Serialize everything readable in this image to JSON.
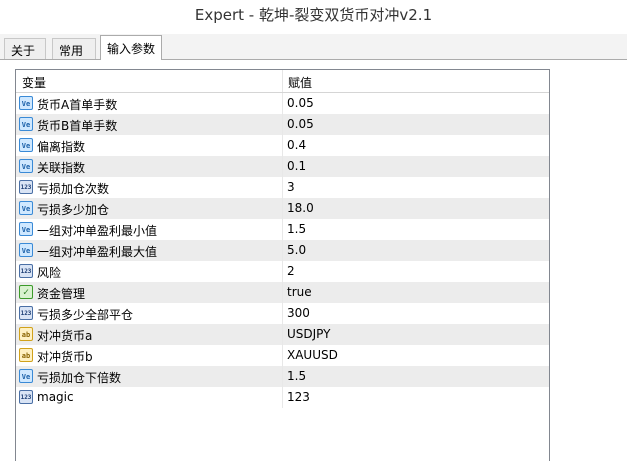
{
  "window": {
    "title": "Expert - 乾坤-裂变双货币对冲v2.1"
  },
  "tabs": [
    {
      "label": "关于"
    },
    {
      "label": "常用"
    },
    {
      "label": "输入参数"
    }
  ],
  "table": {
    "headers": {
      "variable": "变量",
      "value": "赋值"
    },
    "rows": [
      {
        "icon": "double-icon",
        "glyph": "Ve",
        "name": "货币A首单手数",
        "value": "0.05"
      },
      {
        "icon": "double-icon",
        "glyph": "Ve",
        "name": "货币B首单手数",
        "value": "0.05"
      },
      {
        "icon": "double-icon",
        "glyph": "Ve",
        "name": "偏离指数",
        "value": "0.4"
      },
      {
        "icon": "double-icon",
        "glyph": "Ve",
        "name": "关联指数",
        "value": "0.1"
      },
      {
        "icon": "integer-icon",
        "glyph": "123",
        "name": "亏损加仓次数",
        "value": "3"
      },
      {
        "icon": "double-icon",
        "glyph": "Ve",
        "name": "亏损多少加仓",
        "value": "18.0"
      },
      {
        "icon": "double-icon",
        "glyph": "Ve",
        "name": "一组对冲单盈利最小值",
        "value": "1.5"
      },
      {
        "icon": "double-icon",
        "glyph": "Ve",
        "name": "一组对冲单盈利最大值",
        "value": "5.0"
      },
      {
        "icon": "integer-icon",
        "glyph": "123",
        "name": "风险",
        "value": "2"
      },
      {
        "icon": "boolean-icon",
        "glyph": "✓",
        "name": "资金管理",
        "value": "true"
      },
      {
        "icon": "integer-icon",
        "glyph": "123",
        "name": "亏损多少全部平仓",
        "value": "300"
      },
      {
        "icon": "string-icon",
        "glyph": "ab",
        "name": "对冲货币a",
        "value": "USDJPY"
      },
      {
        "icon": "string-icon",
        "glyph": "ab",
        "name": "对冲货币b",
        "value": "XAUUSD"
      },
      {
        "icon": "double-icon",
        "glyph": "Ve",
        "name": "亏损加仓下倍数",
        "value": "1.5"
      },
      {
        "icon": "integer-icon",
        "glyph": "123",
        "name": "magic",
        "value": "123"
      }
    ]
  }
}
